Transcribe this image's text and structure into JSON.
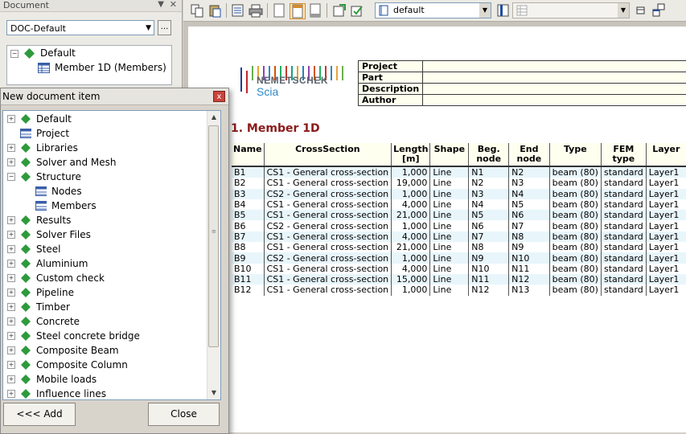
{
  "document_panel": {
    "title": "Document",
    "selected_doc": "DOC-Default",
    "more_label": "...",
    "tree": [
      {
        "label": "Default",
        "type": "folder"
      },
      {
        "label": "Member 1D (Members)",
        "type": "table"
      }
    ]
  },
  "toolbar": {
    "style_value": "default"
  },
  "page": {
    "logo": {
      "name": "NEMETSCHEK",
      "sub": "Scia"
    },
    "info_labels": [
      "Project",
      "Part",
      "Description",
      "Author"
    ],
    "section_title": "1. Member 1D",
    "columns": [
      "Name",
      "CrossSection",
      "Length\n[m]",
      "Shape",
      "Beg. node",
      "End node",
      "Type",
      "FEM type",
      "Layer"
    ],
    "rows": [
      [
        "B1",
        "CS1 - General cross-section",
        "1,000",
        "Line",
        "N1",
        "N2",
        "beam (80)",
        "standard",
        "Layer1"
      ],
      [
        "B2",
        "CS1 - General cross-section",
        "19,000",
        "Line",
        "N2",
        "N3",
        "beam (80)",
        "standard",
        "Layer1"
      ],
      [
        "B3",
        "CS2 - General cross-section",
        "1,000",
        "Line",
        "N3",
        "N4",
        "beam (80)",
        "standard",
        "Layer1"
      ],
      [
        "B4",
        "CS1 - General cross-section",
        "4,000",
        "Line",
        "N4",
        "N5",
        "beam (80)",
        "standard",
        "Layer1"
      ],
      [
        "B5",
        "CS1 - General cross-section",
        "21,000",
        "Line",
        "N5",
        "N6",
        "beam (80)",
        "standard",
        "Layer1"
      ],
      [
        "B6",
        "CS2 - General cross-section",
        "1,000",
        "Line",
        "N6",
        "N7",
        "beam (80)",
        "standard",
        "Layer1"
      ],
      [
        "B7",
        "CS1 - General cross-section",
        "4,000",
        "Line",
        "N7",
        "N8",
        "beam (80)",
        "standard",
        "Layer1"
      ],
      [
        "B8",
        "CS1 - General cross-section",
        "21,000",
        "Line",
        "N8",
        "N9",
        "beam (80)",
        "standard",
        "Layer1"
      ],
      [
        "B9",
        "CS2 - General cross-section",
        "1,000",
        "Line",
        "N9",
        "N10",
        "beam (80)",
        "standard",
        "Layer1"
      ],
      [
        "B10",
        "CS1 - General cross-section",
        "4,000",
        "Line",
        "N10",
        "N11",
        "beam (80)",
        "standard",
        "Layer1"
      ],
      [
        "B11",
        "CS1 - General cross-section",
        "15,000",
        "Line",
        "N11",
        "N12",
        "beam (80)",
        "standard",
        "Layer1"
      ],
      [
        "B12",
        "CS1 - General cross-section",
        "1,000",
        "Line",
        "N12",
        "N13",
        "beam (80)",
        "standard",
        "Layer1"
      ]
    ]
  },
  "dialog": {
    "title": "New document item",
    "close_glyph": "x",
    "items": [
      {
        "label": "Default",
        "level": 0,
        "expander": "+",
        "icon": "diamond"
      },
      {
        "label": "Project",
        "level": 0,
        "expander": "",
        "icon": "table"
      },
      {
        "label": "Libraries",
        "level": 0,
        "expander": "+",
        "icon": "diamond"
      },
      {
        "label": "Solver and Mesh",
        "level": 0,
        "expander": "+",
        "icon": "diamond"
      },
      {
        "label": "Structure",
        "level": 0,
        "expander": "-",
        "icon": "diamond"
      },
      {
        "label": "Nodes",
        "level": 1,
        "expander": "",
        "icon": "table"
      },
      {
        "label": "Members",
        "level": 1,
        "expander": "",
        "icon": "table"
      },
      {
        "label": "Results",
        "level": 0,
        "expander": "+",
        "icon": "diamond"
      },
      {
        "label": "Solver Files",
        "level": 0,
        "expander": "+",
        "icon": "diamond"
      },
      {
        "label": "Steel",
        "level": 0,
        "expander": "+",
        "icon": "diamond"
      },
      {
        "label": "Aluminium",
        "level": 0,
        "expander": "+",
        "icon": "diamond"
      },
      {
        "label": "Custom check",
        "level": 0,
        "expander": "+",
        "icon": "diamond"
      },
      {
        "label": "Pipeline",
        "level": 0,
        "expander": "+",
        "icon": "diamond"
      },
      {
        "label": "Timber",
        "level": 0,
        "expander": "+",
        "icon": "diamond"
      },
      {
        "label": "Concrete",
        "level": 0,
        "expander": "+",
        "icon": "diamond"
      },
      {
        "label": "Steel concrete bridge",
        "level": 0,
        "expander": "+",
        "icon": "diamond"
      },
      {
        "label": "Composite Beam",
        "level": 0,
        "expander": "+",
        "icon": "diamond"
      },
      {
        "label": "Composite Column",
        "level": 0,
        "expander": "+",
        "icon": "diamond"
      },
      {
        "label": "Mobile loads",
        "level": 0,
        "expander": "+",
        "icon": "diamond"
      },
      {
        "label": "Influence lines",
        "level": 0,
        "expander": "+",
        "icon": "diamond"
      }
    ],
    "add_label": "<<< Add",
    "close_label": "Close"
  },
  "colors": {
    "diamond": "#2e9a3c",
    "section_title": "#8b1a1a",
    "row_alt": "#e8f6fc"
  }
}
